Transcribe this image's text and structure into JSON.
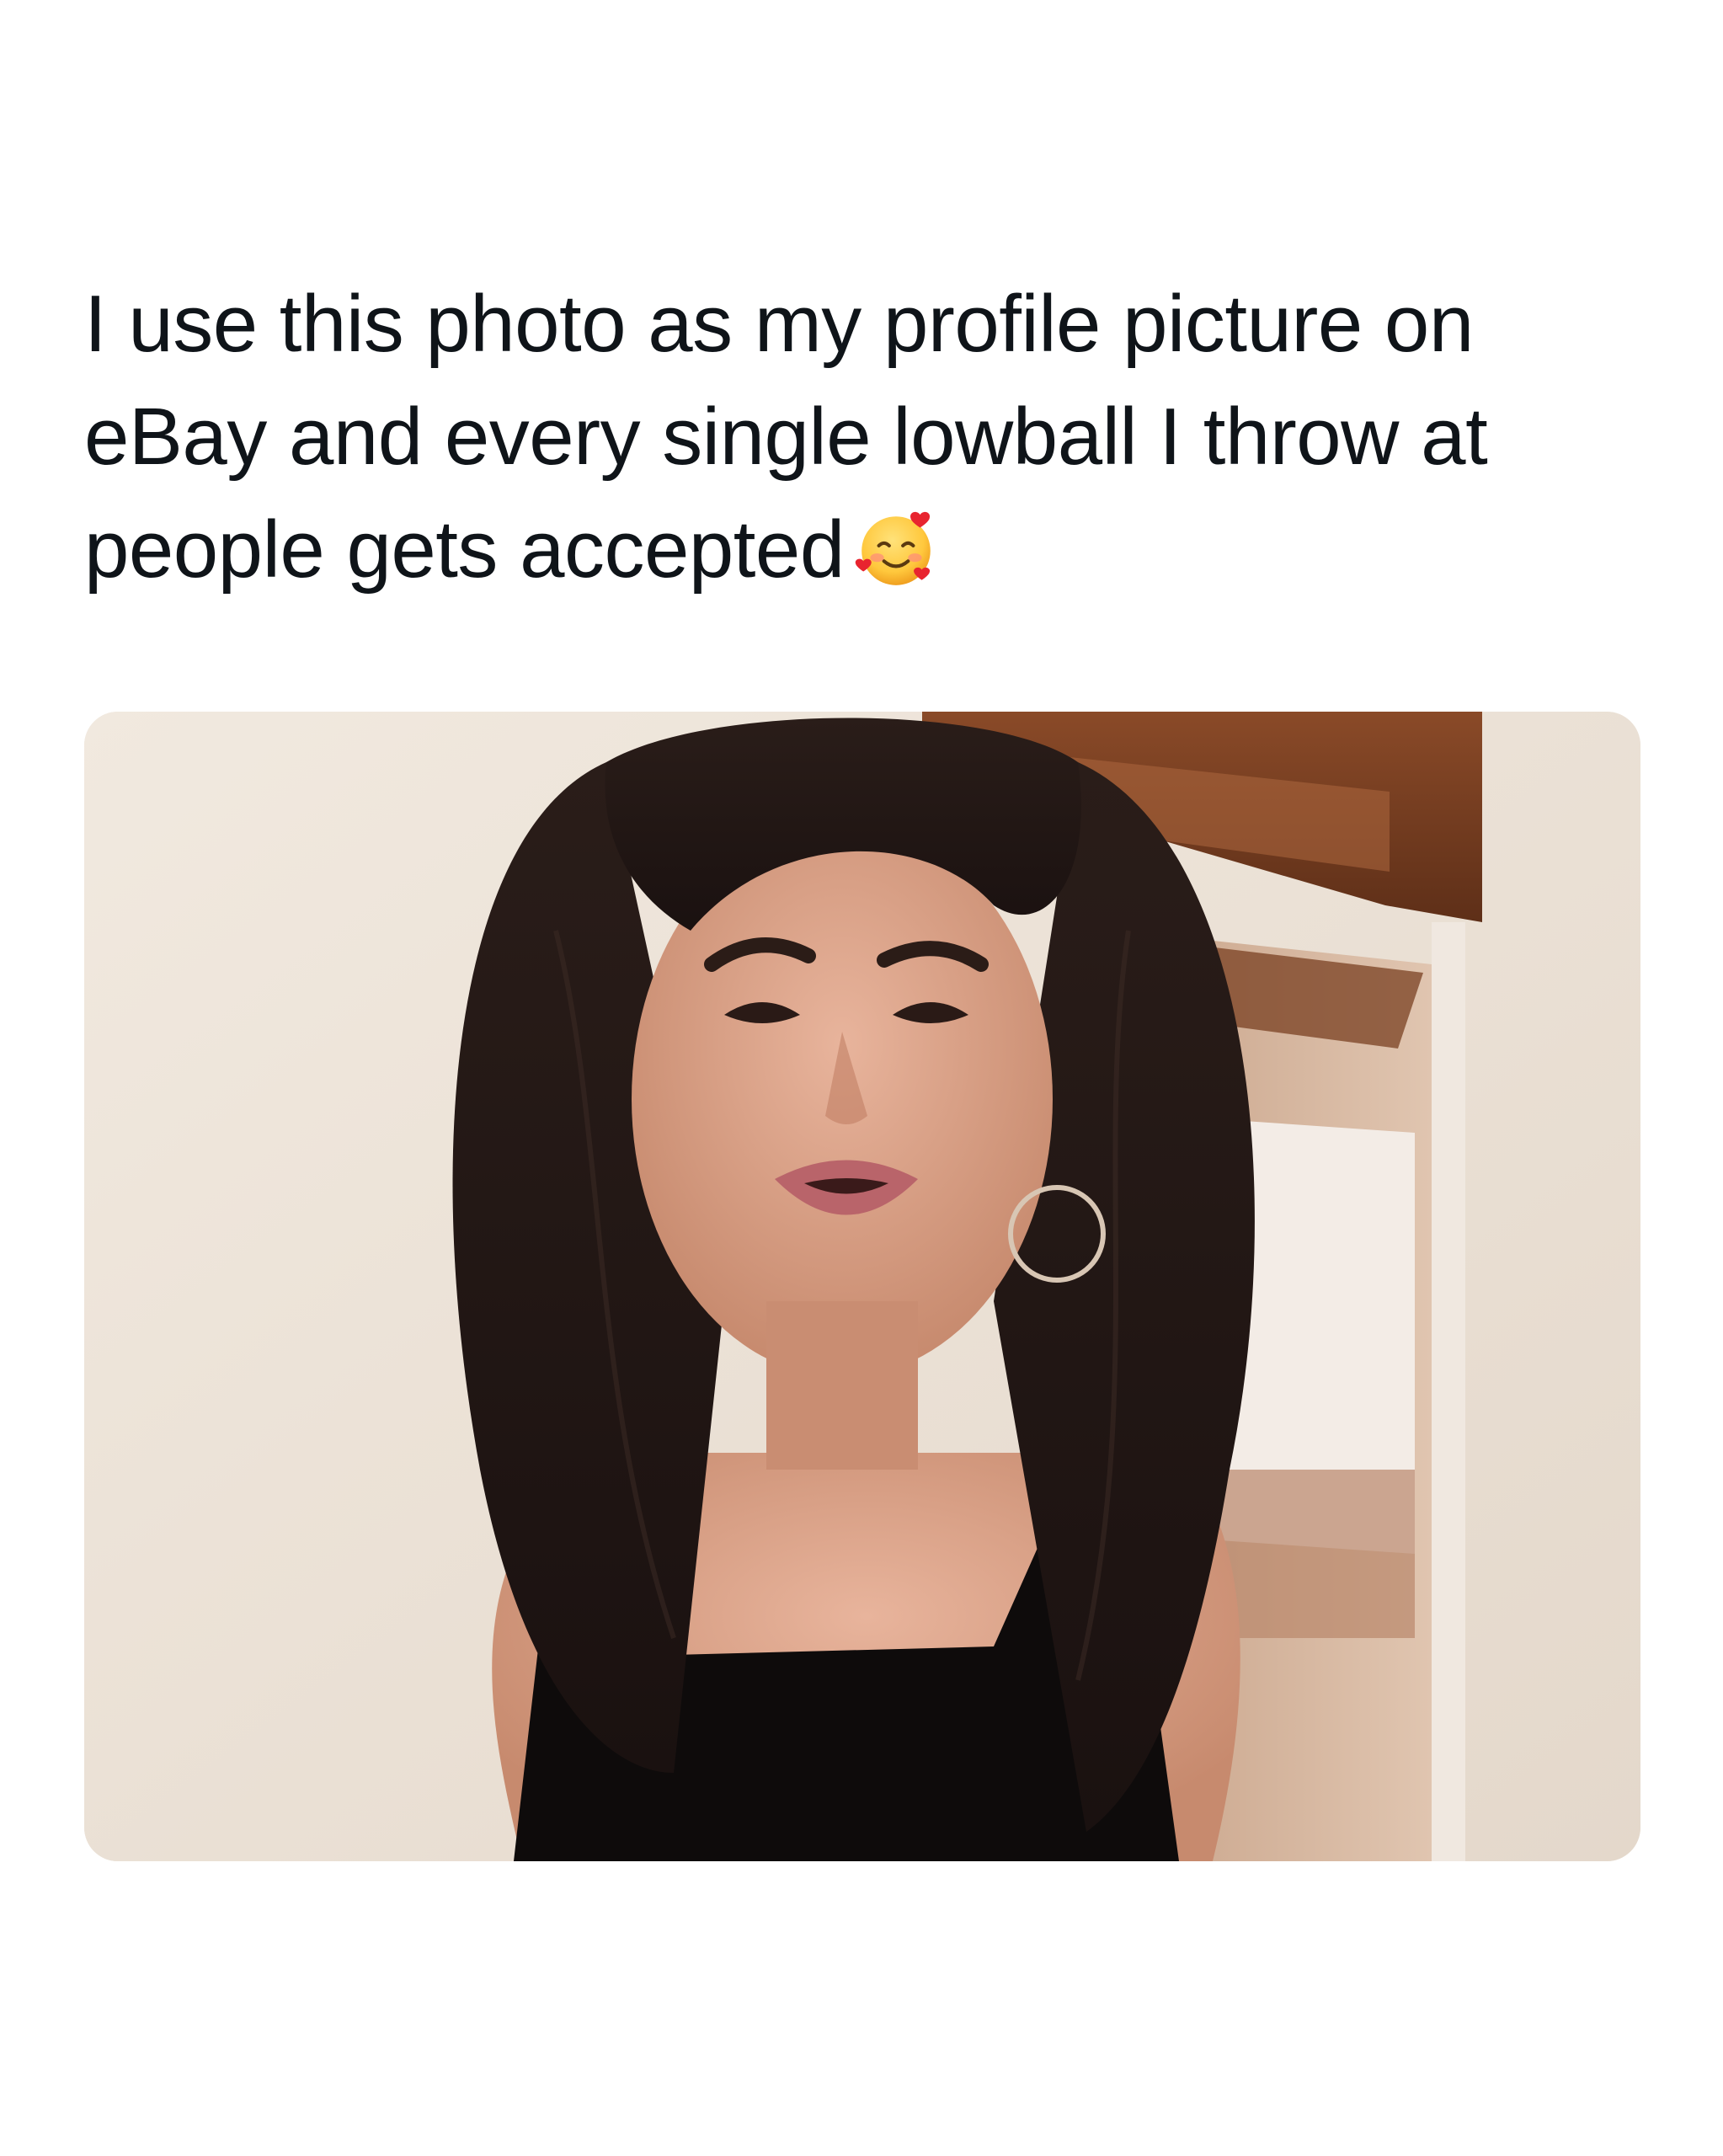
{
  "post": {
    "text": "I use this photo as my profile picture on\neBay and every single lowball I throw at\npeople gets accepted",
    "emoji": "smiling-face-with-hearts-icon"
  },
  "media": {
    "kind": "photo"
  },
  "colors": {
    "background": "#ffffff",
    "text": "#0f1419"
  }
}
